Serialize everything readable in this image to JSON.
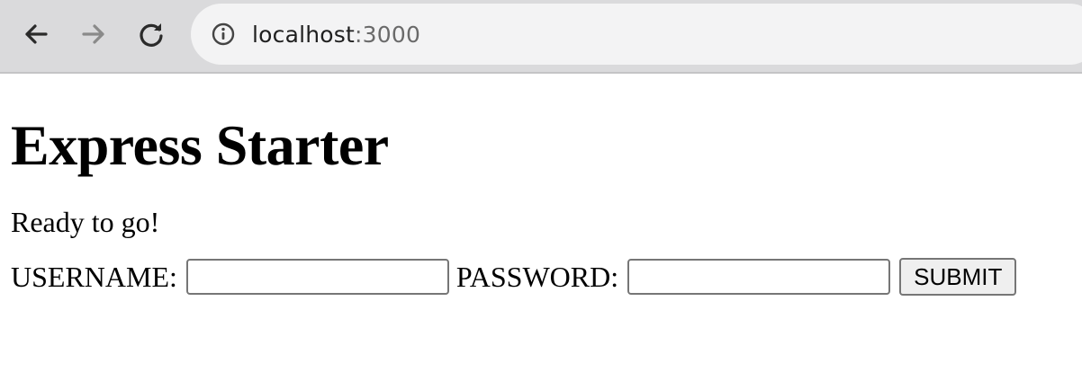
{
  "browser": {
    "url_host": "localhost",
    "url_port": ":3000",
    "icons": {
      "back": "arrow-left-icon",
      "forward": "arrow-right-icon",
      "reload": "reload-icon",
      "site_info": "info-icon"
    }
  },
  "page": {
    "title": "Express Starter",
    "intro": "Ready to go!",
    "form": {
      "username_label": "USERNAME:",
      "username_value": "",
      "password_label": "PASSWORD:",
      "password_value": "",
      "submit_label": "SUBMIT"
    }
  },
  "colors": {
    "toolbar": "#dadadc",
    "omnibox": "#f3f3f4",
    "button_bg": "#efefef",
    "input_border": "#767676"
  }
}
